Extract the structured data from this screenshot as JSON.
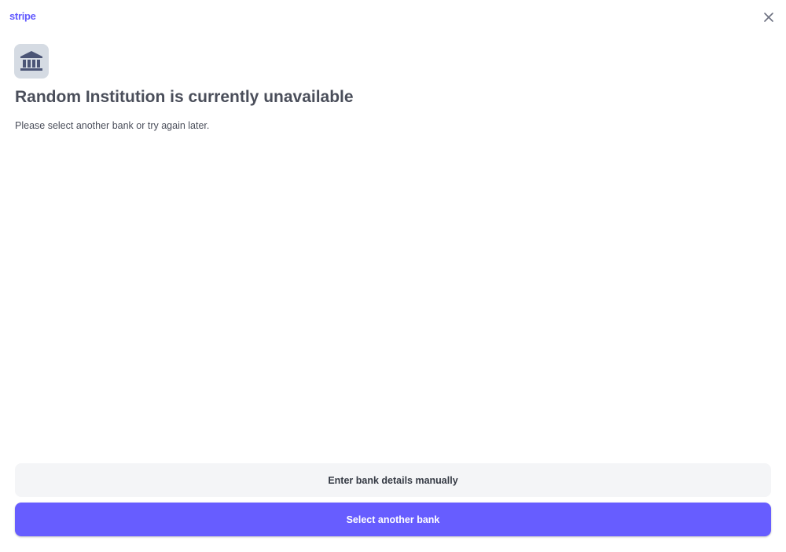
{
  "header": {
    "logo": "stripe"
  },
  "main": {
    "title": "Random Institution is currently unavailable",
    "subtitle": "Please select another bank or try again later."
  },
  "actions": {
    "manual": "Enter bank details manually",
    "select": "Select another bank"
  },
  "colors": {
    "brand": "#635bff",
    "primary_button": "#675dff"
  }
}
